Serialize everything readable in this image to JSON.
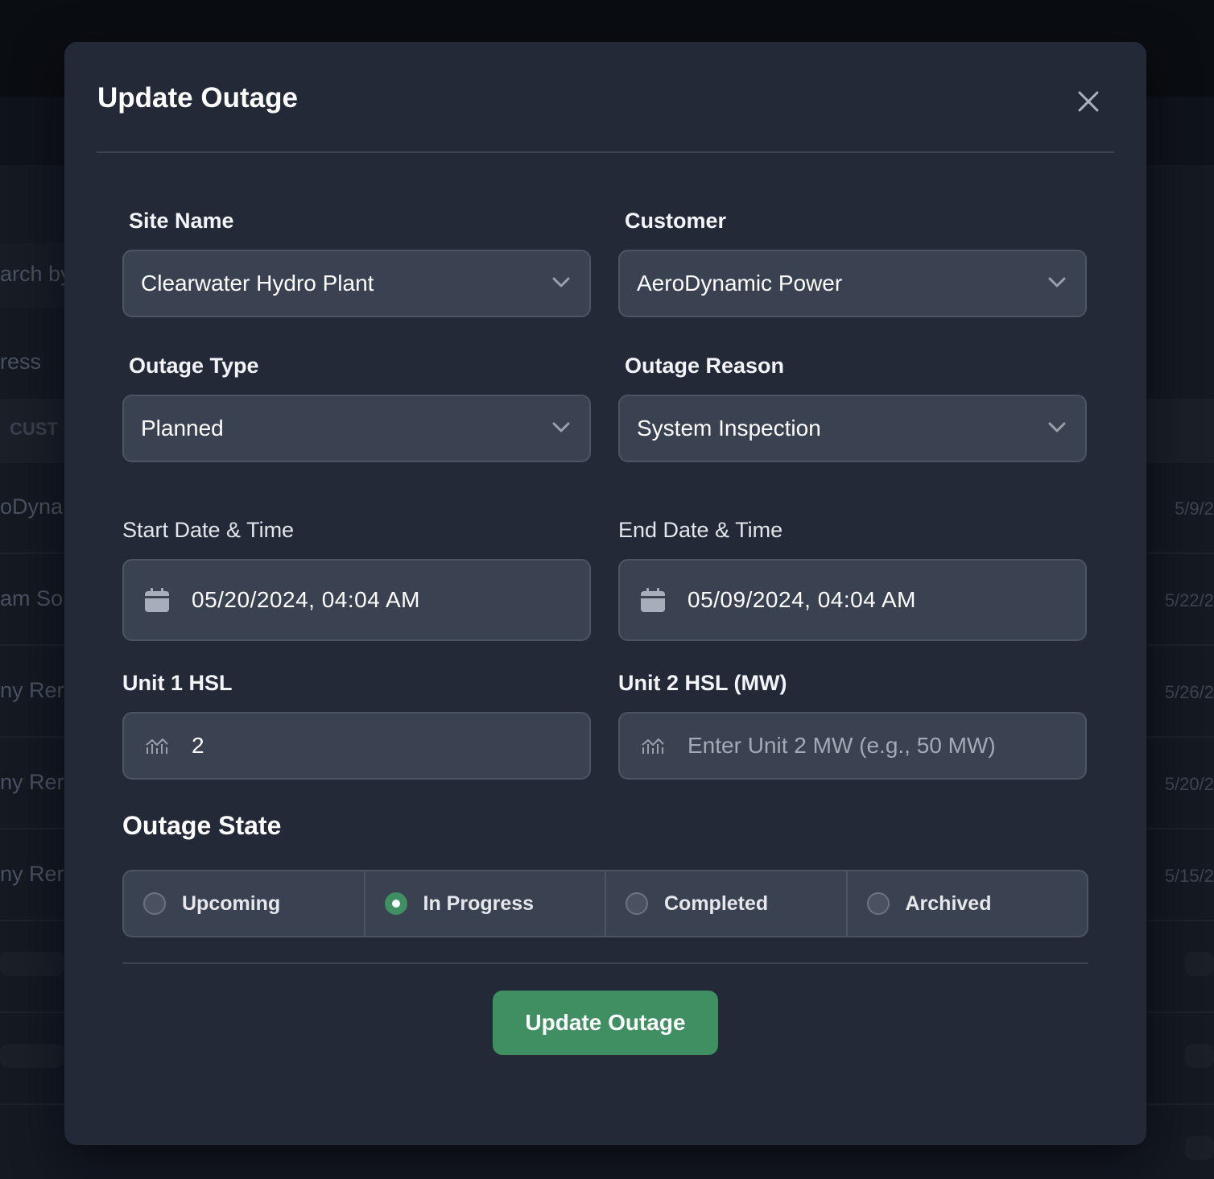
{
  "background": {
    "search_fragment": "arch by",
    "filter_fragment": "ress",
    "column_fragment": "CUST",
    "rows": [
      {
        "customer": "oDyna",
        "date": "5/9/2"
      },
      {
        "customer": "am So",
        "date": "5/22/2"
      },
      {
        "customer": "ny Rer",
        "date": "5/26/2"
      },
      {
        "customer": "ny Rer",
        "date": "5/20/2"
      },
      {
        "customer": "ny Rer",
        "date": "5/15/2"
      }
    ]
  },
  "modal": {
    "title": "Update Outage",
    "close_icon": "close-icon",
    "site_name": {
      "label": "Site Name",
      "value": "Clearwater Hydro Plant"
    },
    "customer": {
      "label": "Customer",
      "value": "AeroDynamic Power"
    },
    "outage_type": {
      "label": "Outage Type",
      "value": "Planned"
    },
    "outage_reason": {
      "label": "Outage Reason",
      "value": "System Inspection"
    },
    "start": {
      "label": "Start Date & Time",
      "value": "05/20/2024, 04:04 AM",
      "icon": "calendar-icon"
    },
    "end": {
      "label": "End Date & Time",
      "value": "05/09/2024, 04:04 AM",
      "icon": "calendar-icon"
    },
    "unit1": {
      "label": "Unit 1 HSL",
      "value": "2",
      "icon": "chart-icon"
    },
    "unit2": {
      "label": "Unit 2 HSL (MW)",
      "value": "",
      "placeholder": "Enter Unit 2 MW (e.g., 50 MW)",
      "icon": "chart-icon"
    },
    "state": {
      "title": "Outage State",
      "options": [
        {
          "label": "Upcoming",
          "checked": false
        },
        {
          "label": "In Progress",
          "checked": true
        },
        {
          "label": "Completed",
          "checked": false
        },
        {
          "label": "Archived",
          "checked": false
        }
      ]
    },
    "submit_label": "Update Outage"
  },
  "colors": {
    "accent": "#3f8f62",
    "modal_bg": "#232937",
    "field_bg": "#3a4150"
  }
}
